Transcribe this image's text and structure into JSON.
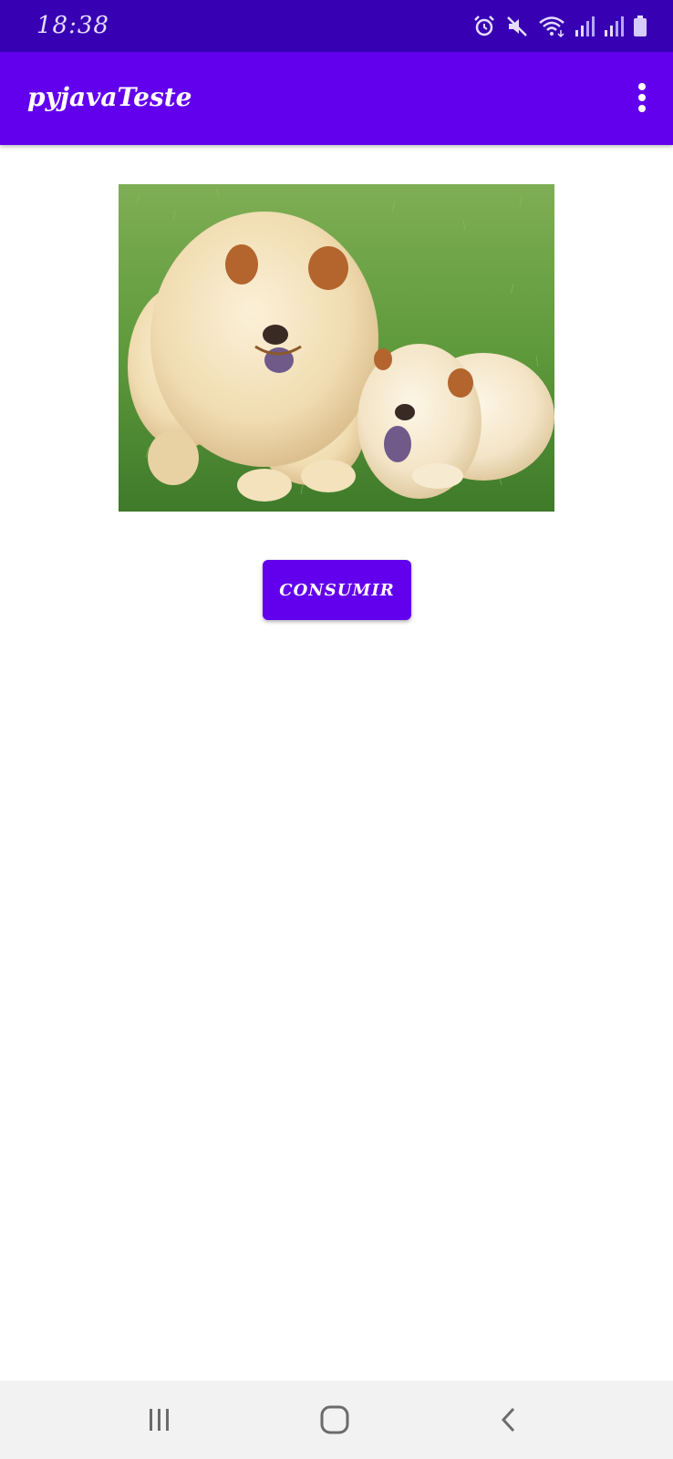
{
  "status_bar": {
    "time": "18:38",
    "icons": [
      "alarm-icon",
      "mute-icon",
      "wifi-icon",
      "signal-icon",
      "signal-icon",
      "battery-icon"
    ]
  },
  "app_bar": {
    "title": "pyjavaTeste",
    "menu_icon": "overflow-menu-icon"
  },
  "main": {
    "image": "two-chow-chow-dogs-on-grass",
    "button_label": "CONSUMIR"
  },
  "nav_bar": {
    "icons": [
      "recent-apps-icon",
      "home-icon",
      "back-icon"
    ]
  },
  "colors": {
    "status_bar": "#3700B3",
    "primary": "#6200EE",
    "background": "#FFFFFF",
    "nav_bar": "#F2F2F2"
  }
}
